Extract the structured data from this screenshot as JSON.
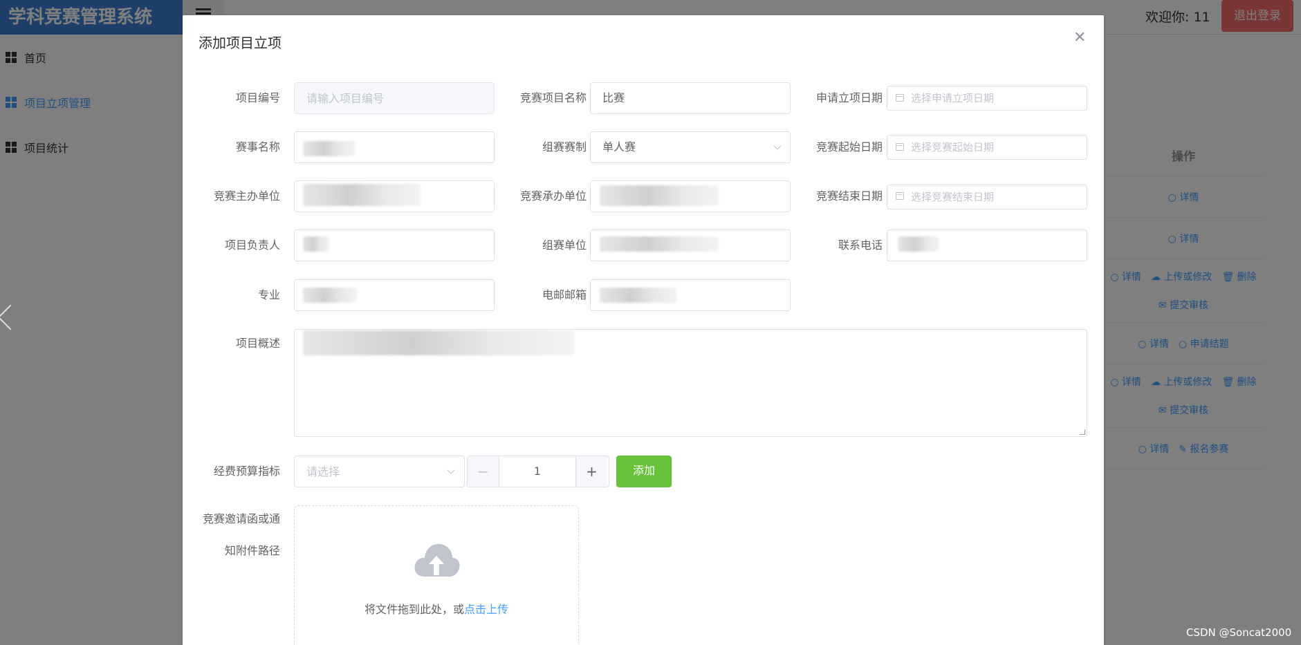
{
  "app": {
    "title": "学科竞赛管理系统",
    "welcome": "欢迎你: 11",
    "logout_label": "退出登录"
  },
  "sidebar": {
    "items": [
      {
        "label": "首页",
        "icon": "grid-icon"
      },
      {
        "label": "项目立项管理",
        "icon": "grid-icon",
        "active": true
      },
      {
        "label": "项目统计",
        "icon": "grid-icon"
      }
    ]
  },
  "background_table": {
    "header": "操作",
    "rows": [
      [
        "详情"
      ],
      [
        "详情"
      ],
      [
        "详情",
        "上传或修改",
        "删除",
        "提交审核"
      ],
      [
        "详情",
        "申请结题"
      ],
      [
        "详情",
        "上传或修改",
        "删除",
        "提交审核"
      ],
      [
        "详情",
        "报名参赛"
      ]
    ]
  },
  "dialog": {
    "title": "添加项目立项",
    "close_icon": "close-icon",
    "fields": {
      "project_no": {
        "label": "项目编号",
        "placeholder": "请输入项目编号"
      },
      "competition_name": {
        "label": "竞赛项目名称",
        "value": "比赛"
      },
      "apply_date": {
        "label": "申请立项日期",
        "placeholder": "选择申请立项日期"
      },
      "event_name": {
        "label": "赛事名称"
      },
      "format": {
        "label": "组赛赛制",
        "value": "单人赛"
      },
      "start_date": {
        "label": "竞赛起始日期",
        "placeholder": "选择竞赛起始日期"
      },
      "organizer": {
        "label": "竞赛主办单位"
      },
      "undertaker": {
        "label": "竞赛承办单位"
      },
      "end_date": {
        "label": "竞赛结束日期",
        "placeholder": "选择竞赛结束日期"
      },
      "leader": {
        "label": "项目负责人"
      },
      "team_unit": {
        "label": "组赛单位"
      },
      "phone": {
        "label": "联系电话"
      },
      "major": {
        "label": "专业"
      },
      "email": {
        "label": "电邮邮箱"
      },
      "summary": {
        "label": "项目概述"
      },
      "budget": {
        "label": "经费预算指标",
        "placeholder": "请选择",
        "quantity": "1",
        "add_label": "添加"
      },
      "attachment": {
        "label_line1": "竞赛邀请函或通",
        "label_line2": "知附件路径",
        "upload_text": "将文件拖到此处，或",
        "upload_link": "点击上传"
      }
    }
  },
  "watermark": "CSDN @Soncat2000",
  "colors": {
    "primary": "#409eff",
    "success": "#67c23a",
    "danger": "#f56c6c",
    "logo_bg": "#3a7ed3"
  }
}
